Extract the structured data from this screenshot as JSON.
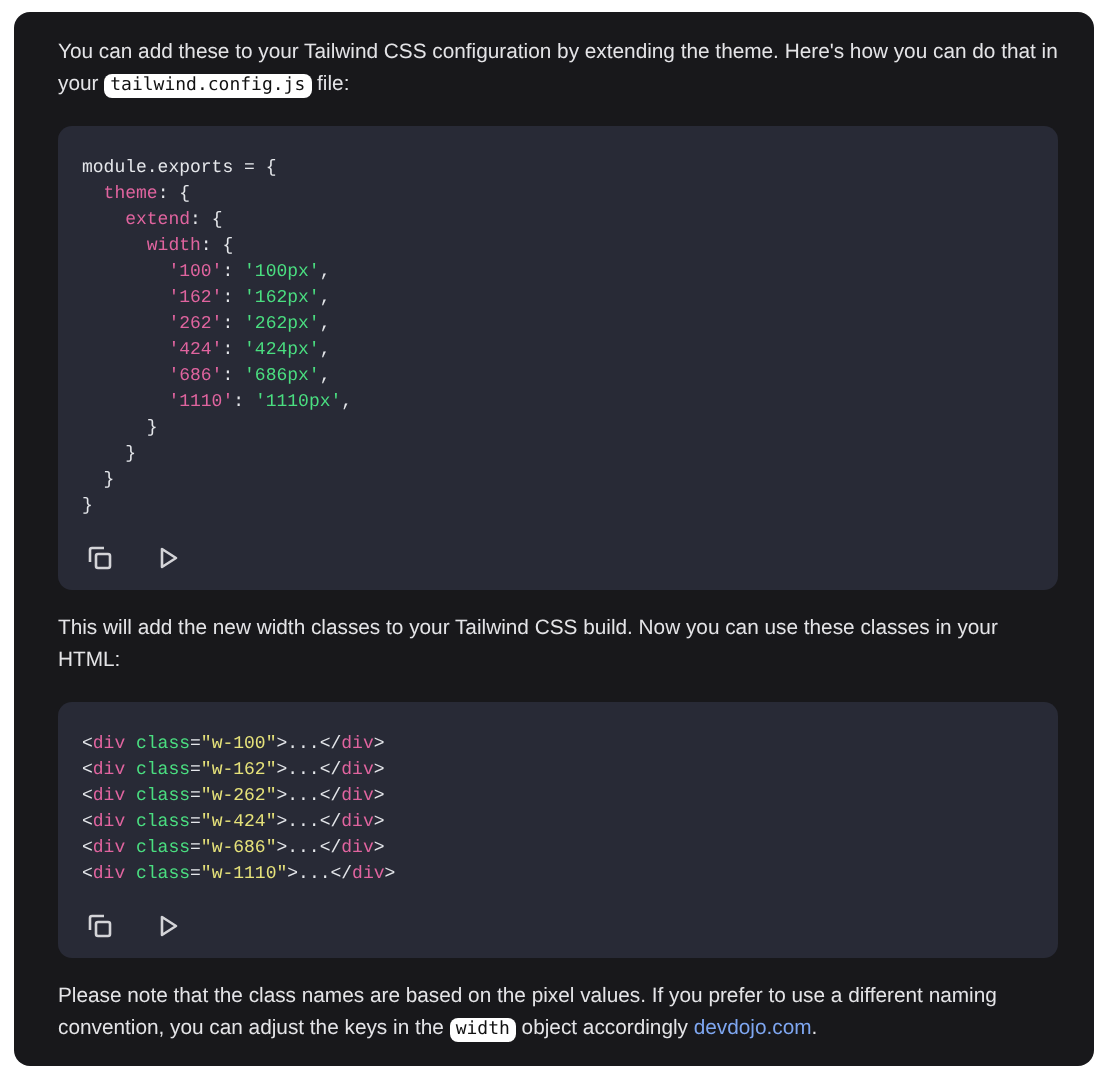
{
  "blocks": [
    {
      "kind": "paragraph",
      "segments": [
        {
          "kind": "text",
          "text": "You can add these to your Tailwind CSS configuration by extending the theme. Here's how you can do that in your "
        },
        {
          "kind": "code",
          "text": "tailwind.config.js"
        },
        {
          "kind": "text",
          "text": " file:"
        }
      ]
    },
    {
      "kind": "code",
      "lines": [
        [
          {
            "kind": "plain",
            "text": "module.exports = {"
          }
        ],
        [
          {
            "kind": "key",
            "text": "  theme"
          },
          {
            "kind": "plain",
            "text": ": {"
          }
        ],
        [
          {
            "kind": "key",
            "text": "    extend"
          },
          {
            "kind": "plain",
            "text": ": {"
          }
        ],
        [
          {
            "kind": "key",
            "text": "      width"
          },
          {
            "kind": "plain",
            "text": ": {"
          }
        ],
        [
          {
            "kind": "key",
            "text": "        '100'"
          },
          {
            "kind": "plain",
            "text": ": "
          },
          {
            "kind": "string",
            "text": "'100px'"
          },
          {
            "kind": "plain",
            "text": ","
          }
        ],
        [
          {
            "kind": "key",
            "text": "        '162'"
          },
          {
            "kind": "plain",
            "text": ": "
          },
          {
            "kind": "string",
            "text": "'162px'"
          },
          {
            "kind": "plain",
            "text": ","
          }
        ],
        [
          {
            "kind": "key",
            "text": "        '262'"
          },
          {
            "kind": "plain",
            "text": ": "
          },
          {
            "kind": "string",
            "text": "'262px'"
          },
          {
            "kind": "plain",
            "text": ","
          }
        ],
        [
          {
            "kind": "key",
            "text": "        '424'"
          },
          {
            "kind": "plain",
            "text": ": "
          },
          {
            "kind": "string",
            "text": "'424px'"
          },
          {
            "kind": "plain",
            "text": ","
          }
        ],
        [
          {
            "kind": "key",
            "text": "        '686'"
          },
          {
            "kind": "plain",
            "text": ": "
          },
          {
            "kind": "string",
            "text": "'686px'"
          },
          {
            "kind": "plain",
            "text": ","
          }
        ],
        [
          {
            "kind": "key",
            "text": "        '1110'"
          },
          {
            "kind": "plain",
            "text": ": "
          },
          {
            "kind": "string",
            "text": "'1110px'"
          },
          {
            "kind": "plain",
            "text": ","
          }
        ],
        [
          {
            "kind": "plain",
            "text": "      }"
          }
        ],
        [
          {
            "kind": "plain",
            "text": "    }"
          }
        ],
        [
          {
            "kind": "plain",
            "text": "  }"
          }
        ],
        [
          {
            "kind": "plain",
            "text": "}"
          }
        ]
      ]
    },
    {
      "kind": "paragraph",
      "segments": [
        {
          "kind": "text",
          "text": "This will add the new width classes to your Tailwind CSS build. Now you can use these classes in your HTML:"
        }
      ]
    },
    {
      "kind": "code",
      "lines": [
        [
          {
            "kind": "plain",
            "text": "<"
          },
          {
            "kind": "tag",
            "text": "div"
          },
          {
            "kind": "attr",
            "text": " class"
          },
          {
            "kind": "plain",
            "text": "="
          },
          {
            "kind": "value",
            "text": "\"w-100\""
          },
          {
            "kind": "plain",
            "text": ">...</"
          },
          {
            "kind": "tag",
            "text": "div"
          },
          {
            "kind": "plain",
            "text": ">"
          }
        ],
        [
          {
            "kind": "plain",
            "text": "<"
          },
          {
            "kind": "tag",
            "text": "div"
          },
          {
            "kind": "attr",
            "text": " class"
          },
          {
            "kind": "plain",
            "text": "="
          },
          {
            "kind": "value",
            "text": "\"w-162\""
          },
          {
            "kind": "plain",
            "text": ">...</"
          },
          {
            "kind": "tag",
            "text": "div"
          },
          {
            "kind": "plain",
            "text": ">"
          }
        ],
        [
          {
            "kind": "plain",
            "text": "<"
          },
          {
            "kind": "tag",
            "text": "div"
          },
          {
            "kind": "attr",
            "text": " class"
          },
          {
            "kind": "plain",
            "text": "="
          },
          {
            "kind": "value",
            "text": "\"w-262\""
          },
          {
            "kind": "plain",
            "text": ">...</"
          },
          {
            "kind": "tag",
            "text": "div"
          },
          {
            "kind": "plain",
            "text": ">"
          }
        ],
        [
          {
            "kind": "plain",
            "text": "<"
          },
          {
            "kind": "tag",
            "text": "div"
          },
          {
            "kind": "attr",
            "text": " class"
          },
          {
            "kind": "plain",
            "text": "="
          },
          {
            "kind": "value",
            "text": "\"w-424\""
          },
          {
            "kind": "plain",
            "text": ">...</"
          },
          {
            "kind": "tag",
            "text": "div"
          },
          {
            "kind": "plain",
            "text": ">"
          }
        ],
        [
          {
            "kind": "plain",
            "text": "<"
          },
          {
            "kind": "tag",
            "text": "div"
          },
          {
            "kind": "attr",
            "text": " class"
          },
          {
            "kind": "plain",
            "text": "="
          },
          {
            "kind": "value",
            "text": "\"w-686\""
          },
          {
            "kind": "plain",
            "text": ">...</"
          },
          {
            "kind": "tag",
            "text": "div"
          },
          {
            "kind": "plain",
            "text": ">"
          }
        ],
        [
          {
            "kind": "plain",
            "text": "<"
          },
          {
            "kind": "tag",
            "text": "div"
          },
          {
            "kind": "attr",
            "text": " class"
          },
          {
            "kind": "plain",
            "text": "="
          },
          {
            "kind": "value",
            "text": "\"w-1110\""
          },
          {
            "kind": "plain",
            "text": ">...</"
          },
          {
            "kind": "tag",
            "text": "div"
          },
          {
            "kind": "plain",
            "text": ">"
          }
        ]
      ]
    },
    {
      "kind": "paragraph",
      "segments": [
        {
          "kind": "text",
          "text": "Please note that the class names are based on the pixel values. If you prefer to use a different naming convention, you can adjust the keys in the "
        },
        {
          "kind": "code",
          "text": "width"
        },
        {
          "kind": "text",
          "text": " object accordingly "
        },
        {
          "kind": "link",
          "text": "devdojo.com"
        },
        {
          "kind": "text",
          "text": "."
        }
      ]
    }
  ]
}
